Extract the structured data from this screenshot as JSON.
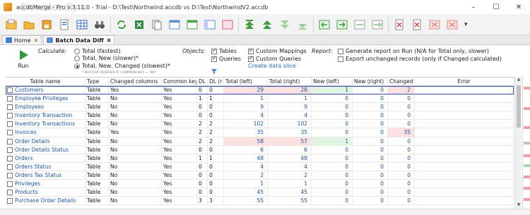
{
  "window": {
    "title": "accdbMerge - Pro v.3.11.0 - Trial - D:\\Test\\Northwind.accdb vs D:\\Test\\NorthwindV2.accdb",
    "watermark": "Downloadly.ir",
    "controls": [
      "–",
      "☐",
      "✕"
    ]
  },
  "tabs": [
    {
      "label": "Home",
      "close": "✕"
    },
    {
      "label": "Batch Data Diff",
      "close": "✖"
    }
  ],
  "run": {
    "label": "Run"
  },
  "calculate": {
    "label": "Calculate:",
    "options": [
      {
        "label": "Total (fastest)",
        "selected": false
      },
      {
        "label": "Total, New (slower)*",
        "selected": false
      },
      {
        "label": "Total, New, Changed (slowest)*",
        "selected": true
      }
    ],
    "note": "* N/A FOR QUERIES IF COMMON KEY = 'NO'"
  },
  "objects": {
    "label": "Objects:",
    "tables": {
      "label": "Tables",
      "checked": true
    },
    "queries": {
      "label": "Queries",
      "checked": true
    },
    "custom_mappings": {
      "label": "Custom Mappings",
      "checked": true
    },
    "custom_queries": {
      "label": "Custom Queries",
      "checked": true
    },
    "slice_link": "Create data slice"
  },
  "report": {
    "label": "Report:",
    "generate": {
      "label": "Generate report on Run (N/A for Total only, slower)",
      "checked": false
    },
    "export": {
      "label": "Export unchanged records (only if Changed calculated)",
      "checked": false
    }
  },
  "grid": {
    "columns": [
      "Table name",
      "Type",
      "Changed columns",
      "Common key",
      "DL (l",
      "DL (r",
      "Total (left)",
      "Total (right)",
      "New (left)",
      "New (right)",
      "Changed",
      "Error"
    ],
    "rows": [
      {
        "name": "Customers",
        "type": "Table",
        "changed_cols": "Yes",
        "key": "Yes",
        "dl_l": "0",
        "dl_r": "0",
        "total_l": "29",
        "total_r": "28",
        "new_l": "1",
        "new_r": "0",
        "changed": "2",
        "error": ""
      },
      {
        "name": "Employee Privileges",
        "type": "Table",
        "changed_cols": "No",
        "key": "Yes",
        "dl_l": "1",
        "dl_r": "1",
        "total_l": "1",
        "total_r": "1",
        "new_l": "0",
        "new_r": "0",
        "changed": "0",
        "error": ""
      },
      {
        "name": "Employees",
        "type": "Table",
        "changed_cols": "No",
        "key": "Yes",
        "dl_l": "0",
        "dl_r": "0",
        "total_l": "9",
        "total_r": "9",
        "new_l": "0",
        "new_r": "0",
        "changed": "0",
        "error": ""
      },
      {
        "name": "Inventory Transaction",
        "type": "Table",
        "changed_cols": "No",
        "key": "Yes",
        "dl_l": "0",
        "dl_r": "0",
        "total_l": "4",
        "total_r": "4",
        "new_l": "0",
        "new_r": "0",
        "changed": "0",
        "error": ""
      },
      {
        "name": "Inventory Transactions",
        "type": "Table",
        "changed_cols": "No",
        "key": "Yes",
        "dl_l": "2",
        "dl_r": "2",
        "total_l": "102",
        "total_r": "102",
        "new_l": "0",
        "new_r": "0",
        "changed": "0",
        "error": ""
      },
      {
        "name": "Invoices",
        "type": "Table",
        "changed_cols": "Yes",
        "key": "Yes",
        "dl_l": "2",
        "dl_r": "2",
        "total_l": "35",
        "total_r": "35",
        "new_l": "0",
        "new_r": "0",
        "changed": "35",
        "error": ""
      },
      {
        "name": "Order Details",
        "type": "Table",
        "changed_cols": "No",
        "key": "Yes",
        "dl_l": "2",
        "dl_r": "2",
        "total_l": "58",
        "total_r": "57",
        "new_l": "1",
        "new_r": "0",
        "changed": "0",
        "error": ""
      },
      {
        "name": "Order Details Status",
        "type": "Table",
        "changed_cols": "No",
        "key": "Yes",
        "dl_l": "0",
        "dl_r": "0",
        "total_l": "6",
        "total_r": "6",
        "new_l": "0",
        "new_r": "0",
        "changed": "0",
        "error": ""
      },
      {
        "name": "Orders",
        "type": "Table",
        "changed_cols": "No",
        "key": "Yes",
        "dl_l": "1",
        "dl_r": "1",
        "total_l": "48",
        "total_r": "48",
        "new_l": "0",
        "new_r": "0",
        "changed": "0",
        "error": ""
      },
      {
        "name": "Orders Status",
        "type": "Table",
        "changed_cols": "No",
        "key": "Yes",
        "dl_l": "0",
        "dl_r": "0",
        "total_l": "4",
        "total_r": "4",
        "new_l": "0",
        "new_r": "0",
        "changed": "0",
        "error": ""
      },
      {
        "name": "Orders Tax Status",
        "type": "Table",
        "changed_cols": "No",
        "key": "Yes",
        "dl_l": "0",
        "dl_r": "0",
        "total_l": "2",
        "total_r": "2",
        "new_l": "0",
        "new_r": "0",
        "changed": "0",
        "error": ""
      },
      {
        "name": "Privileges",
        "type": "Table",
        "changed_cols": "No",
        "key": "Yes",
        "dl_l": "0",
        "dl_r": "0",
        "total_l": "1",
        "total_r": "1",
        "new_l": "0",
        "new_r": "0",
        "changed": "0",
        "error": ""
      },
      {
        "name": "Products",
        "type": "Table",
        "changed_cols": "No",
        "key": "Yes",
        "dl_l": "0",
        "dl_r": "0",
        "total_l": "45",
        "total_r": "45",
        "new_l": "0",
        "new_r": "0",
        "changed": "0",
        "error": ""
      },
      {
        "name": "Purchase Order Details",
        "type": "Table",
        "changed_cols": "No",
        "key": "Yes",
        "dl_l": "3",
        "dl_r": "3",
        "total_l": "55",
        "total_r": "55",
        "new_l": "0",
        "new_r": "0",
        "changed": "0",
        "error": ""
      }
    ]
  },
  "colors": {
    "accent": "#1c55a3",
    "diff_red": "#fbe0e0",
    "diff_green": "#e0f6e2",
    "selection": "#3b4cb8"
  }
}
